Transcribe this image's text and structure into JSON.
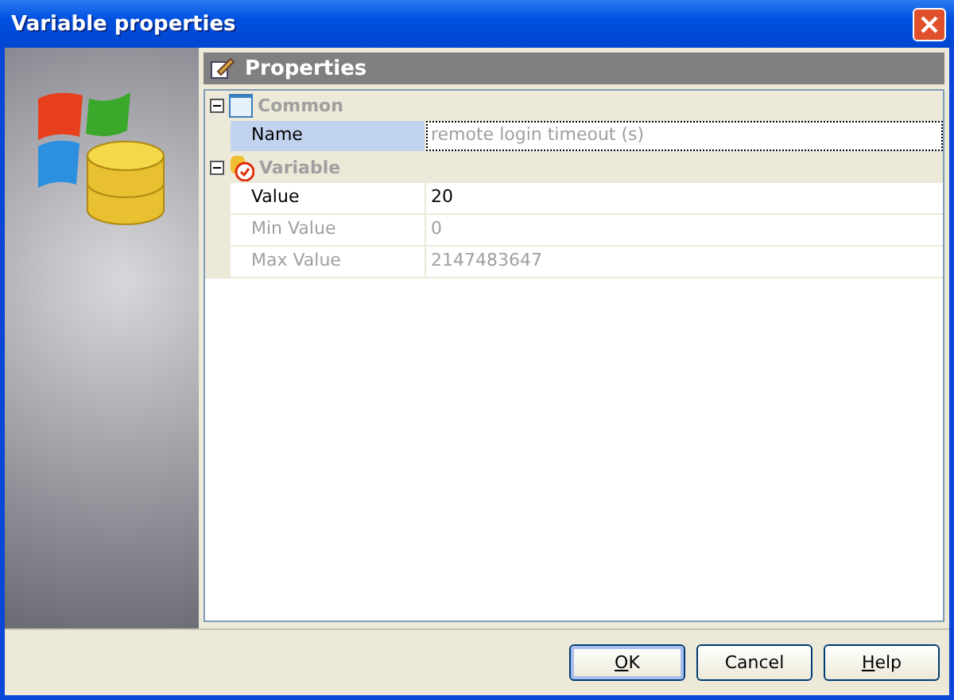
{
  "window": {
    "title": "Variable properties"
  },
  "panel": {
    "title": "Properties"
  },
  "categories": [
    {
      "label": "Common",
      "expanded": true,
      "rows": [
        {
          "name": "Name",
          "value": "remote login timeout (s)",
          "selected": true,
          "disabled": true
        }
      ]
    },
    {
      "label": "Variable",
      "expanded": true,
      "rows": [
        {
          "name": "Value",
          "value": "20",
          "selected": false,
          "disabled": false
        },
        {
          "name": "Min Value",
          "value": "0",
          "selected": false,
          "disabled": true
        },
        {
          "name": "Max Value",
          "value": "2147483647",
          "selected": false,
          "disabled": true
        }
      ]
    }
  ],
  "buttons": [
    {
      "key": "O",
      "rest": "K",
      "default": true
    },
    {
      "rest": "Cancel",
      "default": false
    },
    {
      "key": "H",
      "rest": "elp",
      "default": false
    }
  ]
}
